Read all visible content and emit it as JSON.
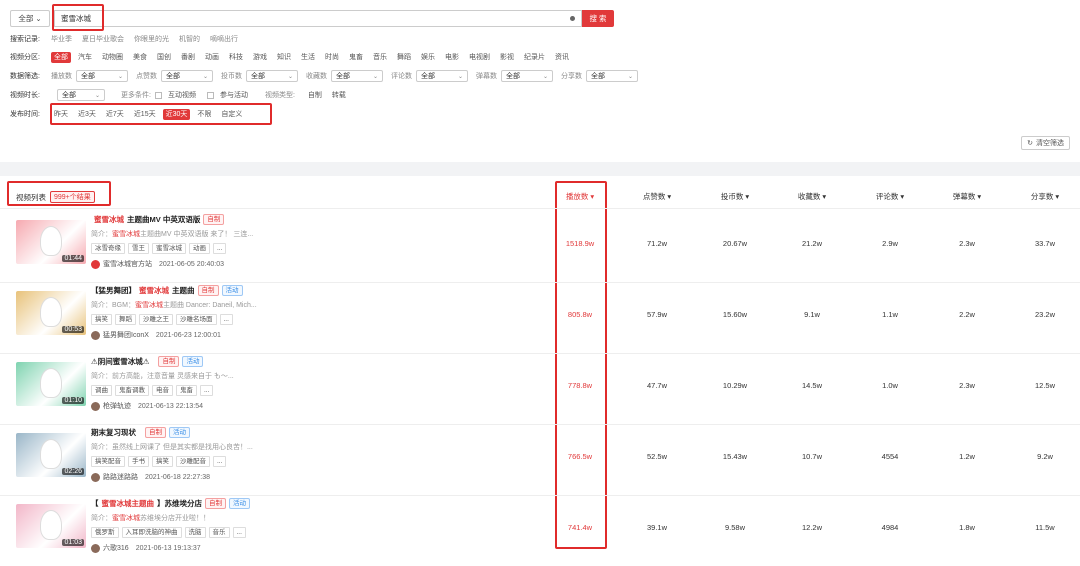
{
  "search": {
    "scope": "全部",
    "query": "蜜雪冰城",
    "button": "搜 索"
  },
  "history": {
    "label": "搜索记录:",
    "items": [
      "毕业季",
      "夏日毕业歌会",
      "你眼里的光",
      "机智的",
      "嘀嘀出行"
    ]
  },
  "partition": {
    "label": "视频分区:",
    "options": [
      "全部",
      "汽车",
      "动物圈",
      "美食",
      "国创",
      "番剧",
      "动画",
      "科技",
      "游戏",
      "知识",
      "生活",
      "时尚",
      "鬼畜",
      "音乐",
      "舞蹈",
      "娱乐",
      "电影",
      "电视剧",
      "影视",
      "纪录片",
      "资讯"
    ],
    "selected": "全部"
  },
  "data_filter": {
    "label": "数据筛选:",
    "fields": [
      {
        "name": "播放数",
        "value": "全部"
      },
      {
        "name": "点赞数",
        "value": "全部"
      },
      {
        "name": "投币数",
        "value": "全部"
      },
      {
        "name": "收藏数",
        "value": "全部"
      },
      {
        "name": "评论数",
        "value": "全部"
      },
      {
        "name": "弹幕数",
        "value": "全部"
      },
      {
        "name": "分享数",
        "value": "全部"
      }
    ]
  },
  "duration": {
    "label": "视频时长:",
    "value": "全部",
    "more_label": "更多条件:",
    "check1": "互动视频",
    "check2": "参与活动",
    "type_label": "视频类型:",
    "type_opts": [
      "自制",
      "转载"
    ]
  },
  "publish": {
    "label": "发布时间:",
    "options": [
      "昨天",
      "近3天",
      "近7天",
      "近15天",
      "近30天",
      "不限",
      "自定义"
    ],
    "selected": "近30天"
  },
  "clear_filter": "清空筛选",
  "results": {
    "title": "视频列表",
    "count": "999+个结果",
    "columns": [
      "播放数",
      "点赞数",
      "投币数",
      "收藏数",
      "评论数",
      "弹幕数",
      "分享数"
    ],
    "active_column": "播放数"
  },
  "videos": [
    {
      "title_hl": "蜜雪冰城",
      "title_rest": "主题曲MV 中英双语版",
      "title_pre": "",
      "badges": [
        "自制"
      ],
      "desc_pre": "简介：",
      "desc_hl": "蜜雪冰城",
      "desc_rest": "主题曲MV 中英双语版 来了！ 三连...",
      "tags": [
        "冰雪奇缘",
        "雪王",
        "蜜雪冰城",
        "动画",
        "..."
      ],
      "author": "蜜雪冰城官方站",
      "date": "2021-06-05 20:40:03",
      "duration": "01:44",
      "stats": [
        "1518.9w",
        "71.2w",
        "20.67w",
        "21.2w",
        "2.9w",
        "2.3w",
        "33.7w"
      ],
      "thumb_color": "#f6a9b0"
    },
    {
      "title_pre": "【猛男舞团】",
      "title_hl": "蜜雪冰城",
      "title_rest": "主题曲",
      "badges": [
        "自制",
        "活动"
      ],
      "desc_pre": "简介：BGM：",
      "desc_hl": "蜜雪冰城",
      "desc_rest": "主题曲 Dancer: Daneil, Mich...",
      "tags": [
        "搞笑",
        "舞蹈",
        "沙雕之王",
        "沙雕名场面",
        "..."
      ],
      "author": "猛男舞团IconX",
      "date": "2021-06-23 12:00:01",
      "duration": "00:53",
      "stats": [
        "805.8w",
        "57.9w",
        "15.60w",
        "9.1w",
        "1.1w",
        "2.2w",
        "23.2w"
      ],
      "thumb_color": "#e8c27a"
    },
    {
      "title_pre": "⚠阴间蜜雪冰城⚠",
      "title_hl": "",
      "title_rest": "",
      "badges": [
        "自制",
        "活动"
      ],
      "desc_pre": "简介：前方高能，注意音量 灵感来自于 も〜...",
      "desc_hl": "",
      "desc_rest": "",
      "tags": [
        "调曲",
        "鬼畜调教",
        "电音",
        "鬼畜",
        "..."
      ],
      "author": "枪弹轨迹",
      "date": "2021-06-13 22:13:54",
      "duration": "01:10",
      "stats": [
        "778.8w",
        "47.7w",
        "10.29w",
        "14.5w",
        "1.0w",
        "2.3w",
        "12.5w"
      ],
      "thumb_color": "#7fd3b0"
    },
    {
      "title_pre": "期末复习现状",
      "title_hl": "",
      "title_rest": "",
      "badges": [
        "自制",
        "活动"
      ],
      "desc_pre": "简介：虽然线上网课了 但是其实都是找用心良苦！...",
      "desc_hl": "",
      "desc_rest": "",
      "tags": [
        "搞笑配音",
        "手书",
        "搞笑",
        "沙雕配音",
        "..."
      ],
      "author": "路路迷路路",
      "date": "2021-06-18 22:27:38",
      "duration": "02:26",
      "stats": [
        "766.5w",
        "52.5w",
        "15.43w",
        "10.7w",
        "4554",
        "1.2w",
        "9.2w"
      ],
      "thumb_color": "#9ab6c8"
    },
    {
      "title_pre": "【",
      "title_hl": "蜜雪冰城主题曲",
      "title_rest": "】苏维埃分店",
      "badges": [
        "自制",
        "活动"
      ],
      "desc_pre": "简介：",
      "desc_hl": "蜜雪冰城",
      "desc_rest": "苏维埃分店开业啦！！",
      "tags": [
        "俄罗斯",
        "入耳即洗脑的神曲",
        "洗脑",
        "音乐",
        "..."
      ],
      "author": "六歌316",
      "date": "2021-06-13 19:13:37",
      "duration": "01:03",
      "stats": [
        "741.4w",
        "39.1w",
        "9.58w",
        "12.2w",
        "4984",
        "1.8w",
        "11.5w"
      ],
      "thumb_color": "#f2b6c8"
    }
  ],
  "colors": {
    "accent": "#e1393a",
    "activity": "#3a8ee6"
  }
}
